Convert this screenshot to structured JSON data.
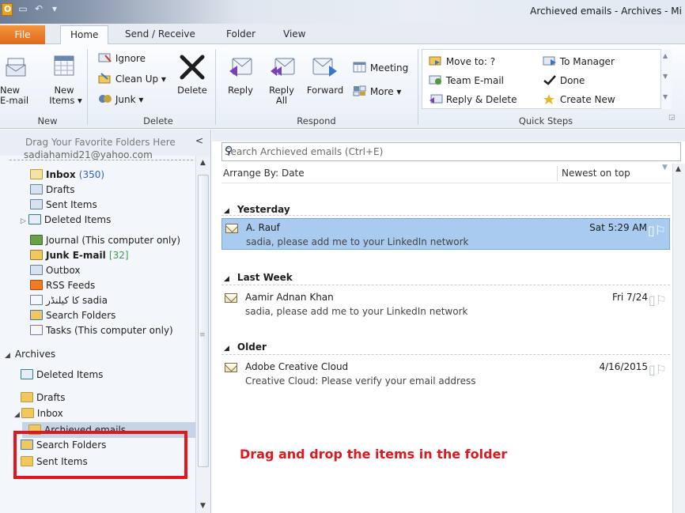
{
  "window": {
    "title": "Archieved emails - Archives - Mi"
  },
  "tabs": {
    "file": "File",
    "home": "Home",
    "send_receive": "Send / Receive",
    "folder": "Folder",
    "view": "View"
  },
  "ribbon": {
    "new_group": {
      "label": "New",
      "new_email": "New\nE-mail",
      "new_email_l1": "New",
      "new_email_l2": "E-mail",
      "new_items_l1": "New",
      "new_items_l2": "Items ▾"
    },
    "delete_group": {
      "label": "Delete",
      "ignore": "Ignore",
      "clean_up": "Clean Up ▾",
      "junk": "Junk ▾",
      "delete": "Delete"
    },
    "respond_group": {
      "label": "Respond",
      "reply": "Reply",
      "reply_all_l1": "Reply",
      "reply_all_l2": "All",
      "forward": "Forward",
      "meeting": "Meeting",
      "more": "More ▾"
    },
    "quick_steps_group": {
      "label": "Quick Steps",
      "items": [
        "Move to: ?",
        "Team E-mail",
        "Reply & Delete",
        "To Manager",
        "Done",
        "Create New"
      ]
    }
  },
  "nav": {
    "drag_hint": "Drag Your Favorite Folders Here",
    "collapse": "<",
    "account_partial": "sadiahamid21@yahoo.com",
    "folders": {
      "inbox": "Inbox",
      "inbox_count": "(350)",
      "drafts": "Drafts",
      "sent": "Sent Items",
      "deleted": "Deleted Items",
      "journal": "Journal (This computer only)",
      "junk": "Junk E-mail",
      "junk_count": "[32]",
      "outbox": "Outbox",
      "rss": "RSS Feeds",
      "calendar": "کا کیلنڈر sadia",
      "search": "Search Folders",
      "tasks": "Tasks (This computer only)"
    },
    "archives": {
      "label": "Archives",
      "deleted": "Deleted Items",
      "drafts": "Drafts",
      "inbox": "Inbox",
      "archieved": "Archieved emails",
      "search": "Search Folders",
      "sent": "Sent Items"
    }
  },
  "mail": {
    "search_placeholder": "Search Archieved emails (Ctrl+E)",
    "arrange_by": "Arrange By: Date",
    "sort_order": "Newest on top",
    "groups": [
      {
        "label": "Yesterday"
      },
      {
        "label": "Last Week"
      },
      {
        "label": "Older"
      }
    ],
    "messages": [
      {
        "from": "A. Rauf",
        "subject": "sadia, please add me to your LinkedIn network",
        "date": "Sat 5:29 AM",
        "selected": true
      },
      {
        "from": "Aamir Adnan Khan",
        "subject": "sadia, please add me to your LinkedIn network",
        "date": "Fri 7/24",
        "selected": false
      },
      {
        "from": "Adobe Creative Cloud",
        "subject": "Creative Cloud: Please verify your email address",
        "date": "4/16/2015",
        "selected": false
      }
    ]
  },
  "annotation": {
    "text": "Drag and drop the items in the folder",
    "color": "#e0181e"
  },
  "colors": {
    "file_tab": "#e1691d",
    "selection": "#a9cbef",
    "count_blue": "#2a62c9",
    "count_green": "#38a045"
  }
}
